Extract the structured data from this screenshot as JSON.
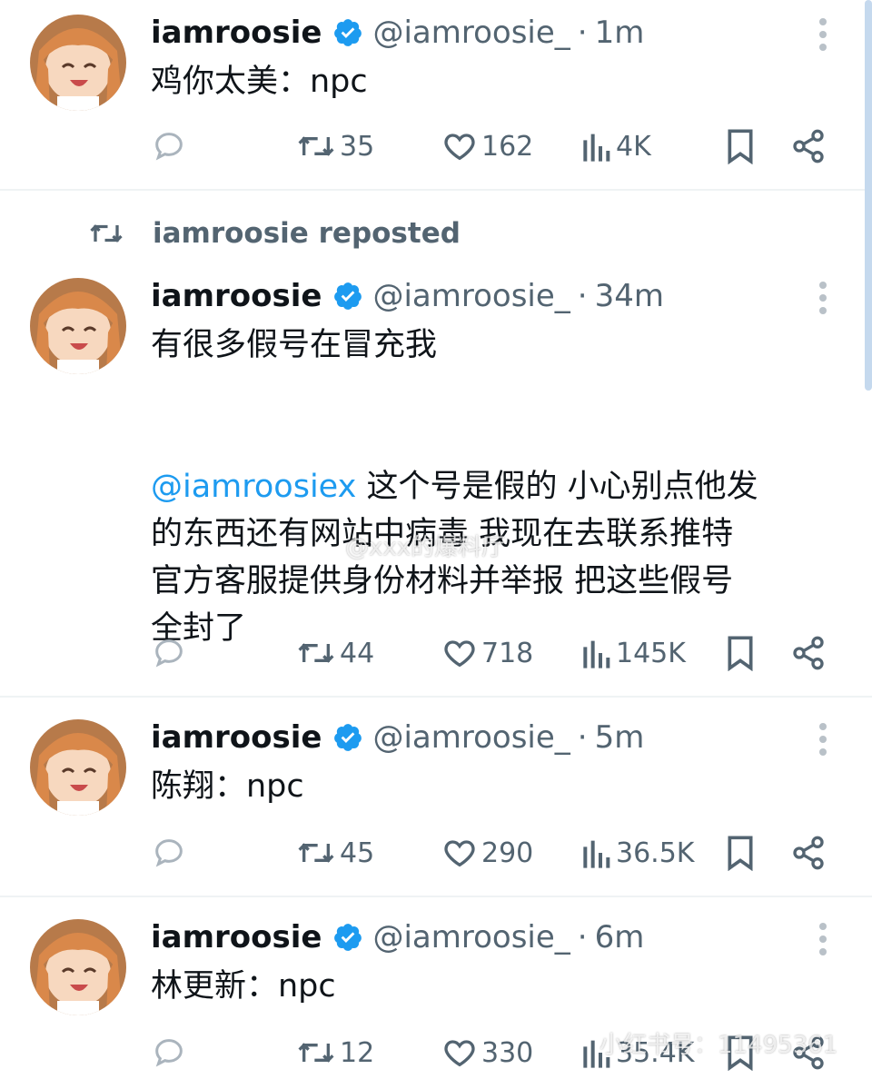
{
  "colors": {
    "text": "#0f1419",
    "secondary": "#536471",
    "mention": "#1d9bf0",
    "verified": "#1d9bf0",
    "divider": "#eff3f4"
  },
  "repost_indicator": {
    "label": "iamroosie reposted",
    "icon": "retweet-icon"
  },
  "tweets": [
    {
      "name": "iamroosie",
      "handle": "@iamroosie_",
      "dot": "·",
      "time": "1m",
      "text_lines": [
        "鸡你太美：npc"
      ],
      "replies": "",
      "retweets": "35",
      "likes": "162",
      "views": "4K"
    },
    {
      "name": "iamroosie",
      "handle": "@iamroosie_",
      "dot": "·",
      "time": "34m",
      "text_first": "有很多假号在冒充我",
      "mention": "@iamroosiex",
      "text_after_mention": " 这个号是假的 小心别点他发",
      "text_lines": [
        "的东西还有网站中病毒 我现在去联系推特",
        "官方客服提供身份材料并举报 把这些假号",
        "全封了"
      ],
      "replies": "",
      "retweets": "44",
      "likes": "718",
      "views": "145K"
    },
    {
      "name": "iamroosie",
      "handle": "@iamroosie_",
      "dot": "·",
      "time": "5m",
      "text_lines": [
        "陈翔：npc"
      ],
      "replies": "",
      "retweets": "45",
      "likes": "290",
      "views": "36.5K"
    },
    {
      "name": "iamroosie",
      "handle": "@iamroosie_",
      "dot": "·",
      "time": "6m",
      "text_lines": [
        "林更新：npc"
      ],
      "replies": "",
      "retweets": "12",
      "likes": "330",
      "views": "35.4K"
    }
  ],
  "watermarks": {
    "weibo": "@xxx的爆料厅",
    "xhs": "小红书号：11495361"
  }
}
